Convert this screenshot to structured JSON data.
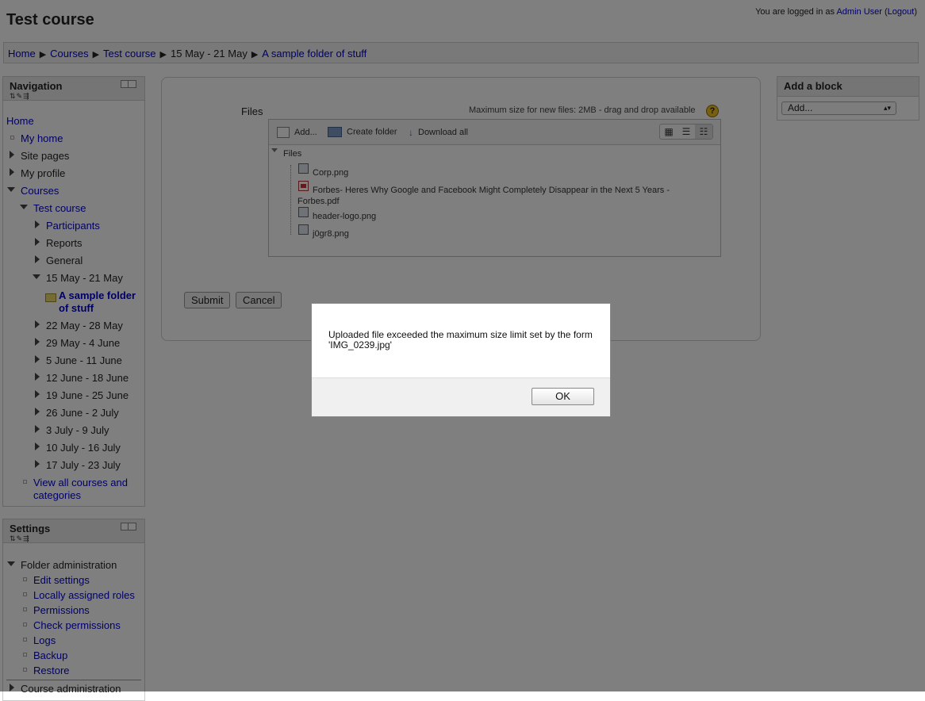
{
  "header": {
    "title": "Test course",
    "login_prefix": "You are logged in as ",
    "user": "Admin User",
    "logout": "Logout"
  },
  "breadcrumb": [
    "Home",
    "Courses",
    "Test course",
    "15 May - 21 May",
    "A sample folder of stuff"
  ],
  "navigation": {
    "title": "Navigation",
    "items": {
      "home": "Home",
      "my_home": "My home",
      "site_pages": "Site pages",
      "my_profile": "My profile",
      "courses": "Courses",
      "test_course": "Test course",
      "participants": "Participants",
      "reports": "Reports",
      "general": "General",
      "week_current": "15 May - 21 May",
      "folder_line1": "A sample folder",
      "folder_line2": "of stuff",
      "w1": "22 May - 28 May",
      "w2": "29 May - 4 June",
      "w3": "5 June - 11 June",
      "w4": "12 June - 18 June",
      "w5": "19 June - 25 June",
      "w6": "26 June - 2 July",
      "w7": "3 July - 9 July",
      "w8": "10 July - 16 July",
      "w9": "17 July - 23 July",
      "view_all_line1": "View all courses and",
      "view_all_line2": "categories"
    }
  },
  "settings": {
    "title": "Settings",
    "folder_admin": "Folder administration",
    "items": [
      "Edit settings",
      "Locally assigned roles",
      "Permissions",
      "Check permissions",
      "Logs",
      "Backup",
      "Restore"
    ],
    "course_admin": "Course administration"
  },
  "add_block": {
    "title": "Add a block",
    "select_value": "Add..."
  },
  "filemanager": {
    "label": "Files",
    "max_size": "Maximum size for new files: 2MB - drag and drop available",
    "toolbar": {
      "add": "Add...",
      "create_folder": "Create folder",
      "download_all": "Download all"
    },
    "root": "Files",
    "files": [
      "Corp.png",
      "Forbes- Heres Why Google and Facebook Might Completely Disappear in the Next 5 Years -",
      "Forbes.pdf",
      "header-logo.png",
      "j0gr8.png"
    ]
  },
  "form": {
    "submit": "Submit",
    "cancel": "Cancel"
  },
  "dialog": {
    "message": "Uploaded file exceeded the maximum size limit set by the form 'IMG_0239.jpg'",
    "ok": "OK"
  }
}
